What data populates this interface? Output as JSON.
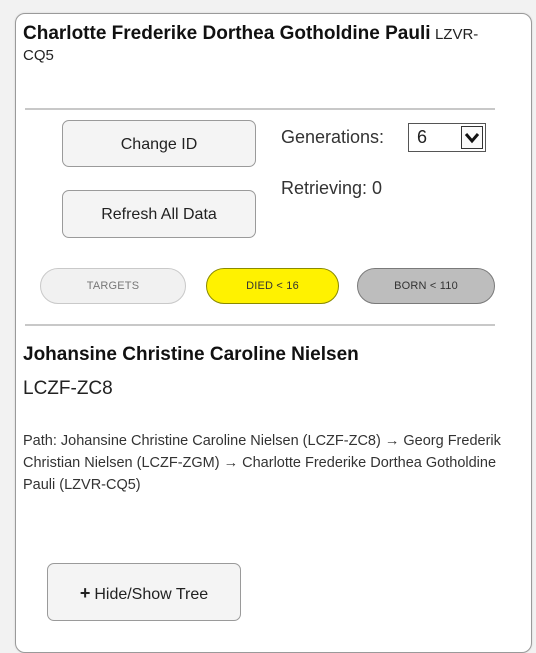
{
  "header": {
    "name": "Charlotte Frederike Dorthea Gotholdine Pauli",
    "id": "LZVR-CQ5"
  },
  "controls": {
    "change_id_label": "Change ID",
    "refresh_label": "Refresh All Data",
    "generations_label": "Generations:",
    "generations_value": "6",
    "retrieving_text": "Retrieving: 0"
  },
  "filters": {
    "targets_label": "TARGETS",
    "died_label": "DIED < 16",
    "born_label": "BORN < 110",
    "died_color": "#fff200",
    "born_color": "#bdbdbd"
  },
  "person": {
    "name": "Johansine Christine Caroline Nielsen",
    "id": "LCZF-ZC8",
    "path": "Path: Johansine Christine Caroline Nielsen (LCZF-ZC8) → Georg Frederik Christian Nielsen (LCZF-ZGM) → Charlotte Frederike Dorthea Gotholdine Pauli (LZVR-CQ5)",
    "tree_button_plus": "+",
    "tree_button_label": "Hide/Show Tree"
  }
}
